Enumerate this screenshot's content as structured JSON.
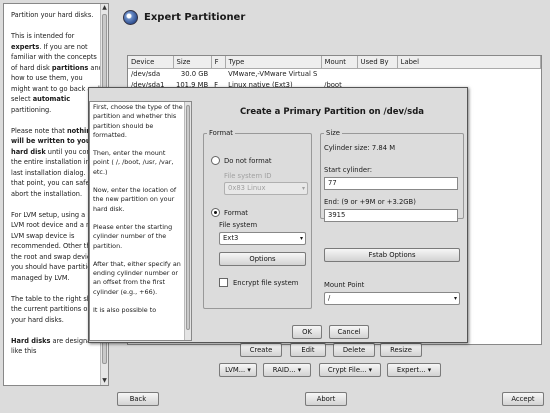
{
  "help": {
    "paragraphs": [
      "Partition your hard disks.",
      "This is intended for experts. If you are not familiar with the concepts of hard disk partitions and how to use them, you might want to go back and select automatic partitioning.",
      "Please note that nothing will be written to your hard disk until you confirm the entire installation in the last installation dialog. Until that point, you can safely abort the installation.",
      "For LVM setup, using a non-LVM root device and a non-LVM swap device is recommended. Other than the root and swap devices, you should have partitions managed by LVM.",
      "The table to the right shows the current partitions on all your hard disks.",
      "Hard disks are designated like this"
    ]
  },
  "main": {
    "title": "Expert Partitioner",
    "table": {
      "headers": [
        "Device",
        "Size",
        "F",
        "Type",
        "Mount",
        "Used By",
        "Label"
      ],
      "rows": [
        [
          "/dev/sda",
          "30.0 GB",
          "",
          "VMware,-VMware Virtual S",
          "",
          "",
          ""
        ],
        [
          "/dev/sda1",
          "101.9 MB",
          "F",
          "Linux native (Ext3)",
          "/boot",
          "",
          ""
        ]
      ]
    },
    "buttons": {
      "create": "Create",
      "edit": "Edit",
      "delete": "Delete",
      "resize": "Resize",
      "lvm": "LVM...",
      "raid": "RAID...",
      "crypt_file": "Crypt File...",
      "expert": "Expert..."
    }
  },
  "footer": {
    "back": "Back",
    "abort": "Abort",
    "accept": "Accept"
  },
  "dialog": {
    "title": "Create a Primary Partition on /dev/sda",
    "help": [
      "First, choose the type of the partition and whether this partition should be formatted.",
      "Then, enter the mount point ( /, /boot, /usr, /var, etc.)",
      "Now, enter the location of the new partition on your hard disk.",
      "Please enter the starting cylinder number of the partition.",
      "After that, either specify an ending cylinder number or an offset from the first cylinder (e.g., +66).",
      "It is also possible to"
    ],
    "format": {
      "group_label": "Format",
      "do_not_format": "Do not format",
      "file_system_id_label": "File system ID",
      "file_system_id_value": "0x83 Linux",
      "format_label": "Format",
      "file_system_label": "File system",
      "file_system_value": "Ext3",
      "options_button": "Options",
      "encrypt_label": "Encrypt file system"
    },
    "size": {
      "group_label": "Size",
      "cylinder_size": "Cylinder size: 7.84 M",
      "start_label": "Start cylinder:",
      "start_value": "77",
      "end_label": "End:  (9 or +9M or +3.2GB)",
      "end_value": "3915",
      "fstab_button": "Fstab Options",
      "mount_label": "Mount Point",
      "mount_value": "/"
    },
    "ok": "OK",
    "cancel": "Cancel"
  }
}
